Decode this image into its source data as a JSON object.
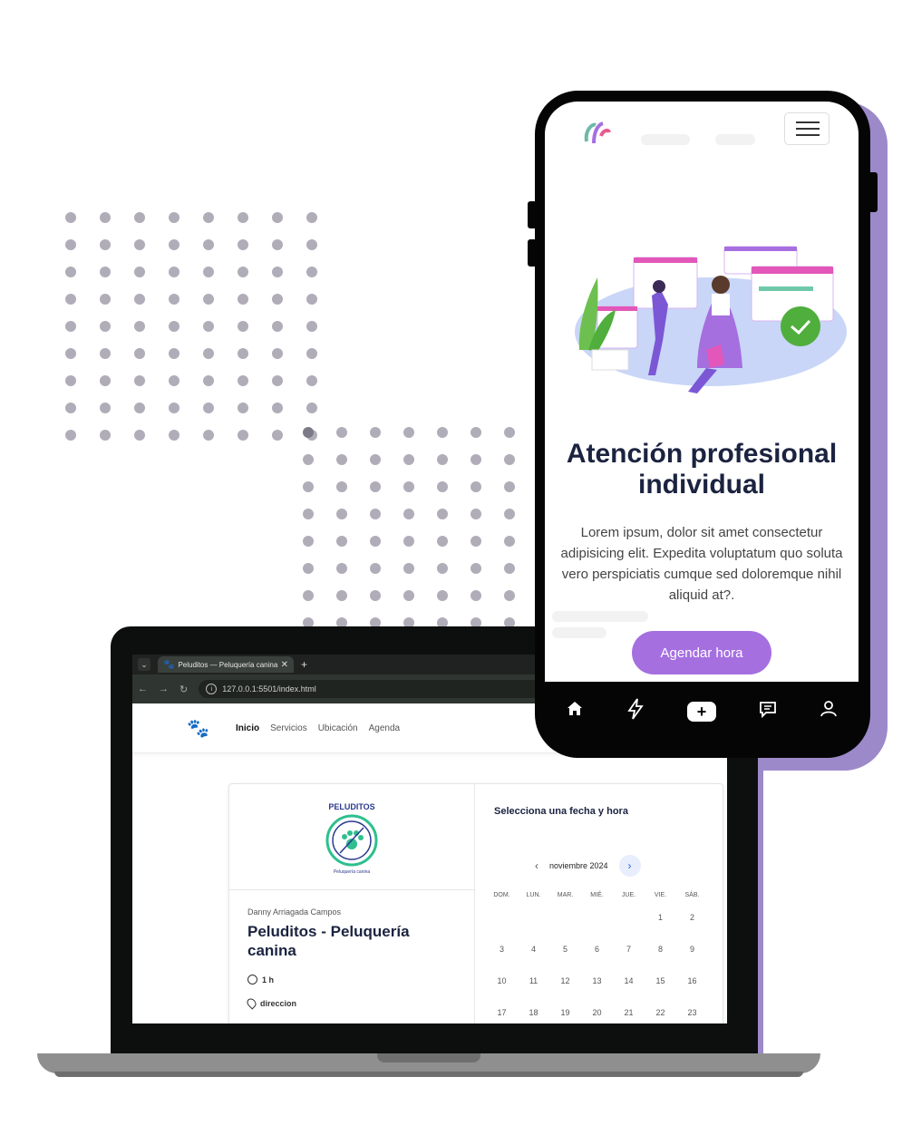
{
  "laptop": {
    "tab_title": "Peluditos — Peluquería canina",
    "url": "127.0.0.1:5501/index.html",
    "nav": [
      "Inicio",
      "Servicios",
      "Ubicación",
      "Agenda"
    ],
    "logo_text": "PELUDITOS",
    "logo_sub": "Peluquería canina",
    "owner": "Danny Arriagada Campos",
    "business": "Peluditos - Peluquería canina",
    "duration": "1 h",
    "location": "direccion",
    "calendar": {
      "title": "Selecciona una fecha y hora",
      "month": "noviembre 2024",
      "weekdays": [
        "DOM.",
        "LUN.",
        "MAR.",
        "MIÉ.",
        "JUE.",
        "VIE.",
        "SÁB."
      ],
      "days": [
        "",
        "",
        "",
        "",
        "",
        "1",
        "2",
        "3",
        "4",
        "5",
        "6",
        "7",
        "8",
        "9",
        "10",
        "11",
        "12",
        "13",
        "14",
        "15",
        "16",
        "17",
        "18",
        "19",
        "20",
        "21",
        "22",
        "23"
      ]
    }
  },
  "phone": {
    "hero_title": "Atención profesional individual",
    "hero_text": "Lorem ipsum, dolor sit amet consectetur adipisicing elit. Expedita voluptatum quo soluta vero perspiciatis cumque sed doloremque nihil aliquid at?.",
    "cta": "Agendar hora",
    "nav_icons": [
      "home-icon",
      "bolt-icon",
      "plus-icon",
      "chat-icon",
      "user-icon"
    ]
  },
  "colors": {
    "accent_purple": "#a56fe0",
    "band_purple": "#9c89c9",
    "brand_green": "#2fbf8f",
    "navy": "#1b2340"
  }
}
